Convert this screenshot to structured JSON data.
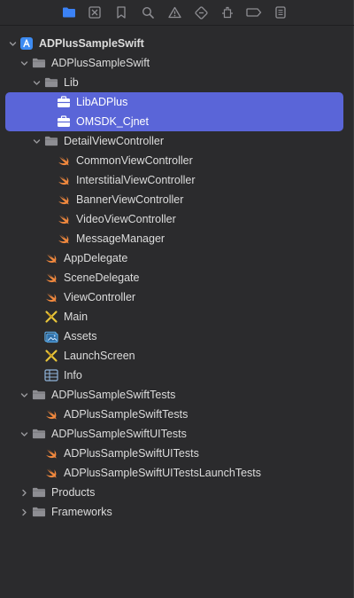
{
  "toolbar": {
    "buttons": [
      {
        "name": "project-navigator-icon",
        "active": true
      },
      {
        "name": "source-control-icon"
      },
      {
        "name": "bookmark-icon"
      },
      {
        "name": "find-icon"
      },
      {
        "name": "issue-icon"
      },
      {
        "name": "test-icon"
      },
      {
        "name": "debug-icon"
      },
      {
        "name": "breakpoint-icon"
      },
      {
        "name": "report-icon"
      }
    ],
    "active_color": "#3b82f6",
    "inactive_color": "#8e8e93"
  },
  "colors": {
    "selection": "#5a65d8",
    "text": "#dcdcdc",
    "swift": "#f0883e",
    "folder": "#8e8e93",
    "app": "#3d8bf2"
  },
  "tree": [
    {
      "label": "ADPlusSampleSwift",
      "icon": "app-project-icon",
      "expanded": true,
      "bold": true
    },
    {
      "label": "ADPlusSampleSwift",
      "icon": "folder-icon",
      "expanded": true
    },
    {
      "label": "Lib",
      "icon": "folder-icon",
      "expanded": true
    },
    {
      "label": "LibADPlus",
      "icon": "framework-icon",
      "selected": true
    },
    {
      "label": "OMSDK_Cjnet",
      "icon": "framework-icon",
      "selected": true
    },
    {
      "label": "DetailViewController",
      "icon": "folder-icon",
      "expanded": true
    },
    {
      "label": "CommonViewController",
      "icon": "swift-file-icon"
    },
    {
      "label": "InterstitialViewController",
      "icon": "swift-file-icon"
    },
    {
      "label": "BannerViewController",
      "icon": "swift-file-icon"
    },
    {
      "label": "VideoViewController",
      "icon": "swift-file-icon"
    },
    {
      "label": "MessageManager",
      "icon": "swift-file-icon"
    },
    {
      "label": "AppDelegate",
      "icon": "swift-file-icon"
    },
    {
      "label": "SceneDelegate",
      "icon": "swift-file-icon"
    },
    {
      "label": "ViewController",
      "icon": "swift-file-icon"
    },
    {
      "label": "Main",
      "icon": "storyboard-icon"
    },
    {
      "label": "Assets",
      "icon": "asset-catalog-icon"
    },
    {
      "label": "LaunchScreen",
      "icon": "storyboard-icon"
    },
    {
      "label": "Info",
      "icon": "plist-icon"
    },
    {
      "label": "ADPlusSampleSwiftTests",
      "icon": "folder-icon",
      "expanded": true
    },
    {
      "label": "ADPlusSampleSwiftTests",
      "icon": "swift-file-icon"
    },
    {
      "label": "ADPlusSampleSwiftUITests",
      "icon": "folder-icon",
      "expanded": true
    },
    {
      "label": "ADPlusSampleSwiftUITests",
      "icon": "swift-file-icon"
    },
    {
      "label": "ADPlusSampleSwiftUITestsLaunchTests",
      "icon": "swift-file-icon"
    },
    {
      "label": "Products",
      "icon": "folder-icon",
      "expanded": false
    },
    {
      "label": "Frameworks",
      "icon": "folder-icon",
      "expanded": false
    }
  ]
}
